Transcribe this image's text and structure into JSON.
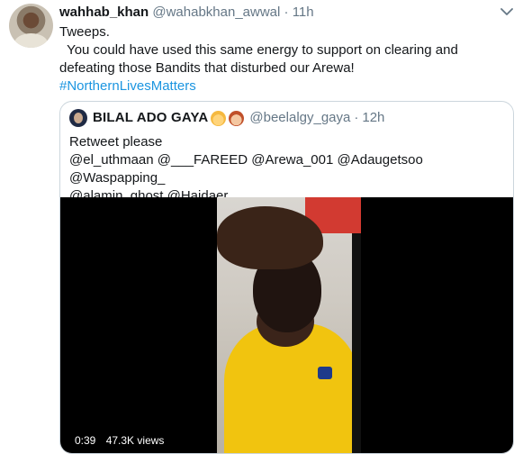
{
  "tweet": {
    "name": "wahhab_khan",
    "handle": "@wahabkhan_awwal",
    "separator": "·",
    "time": "11h",
    "lines": [
      "Tweeps.",
      "  You could have used this same energy to support on clearing and",
      "defeating those Bandits that disturbed our Arewa!"
    ],
    "hashtag": "#NorthernLivesMatters"
  },
  "quote": {
    "name": "BILAL ADO GAYA",
    "handle": "@beelalgy_gaya",
    "separator": "·",
    "time": "12h",
    "line1": "Retweet please",
    "line2": "@el_uthmaan @___FAREED @Arewa_001 @Adaugetsoo @Waspapping_",
    "line3": "@alamin_ghost @Haidaer__"
  },
  "video": {
    "duration": "0:39",
    "views": "47.3K views"
  },
  "icons": {
    "caret": "chevron-down-icon"
  },
  "colors": {
    "link": "#1b95e0",
    "secondary": "#657786",
    "border": "#ccd6dd"
  }
}
